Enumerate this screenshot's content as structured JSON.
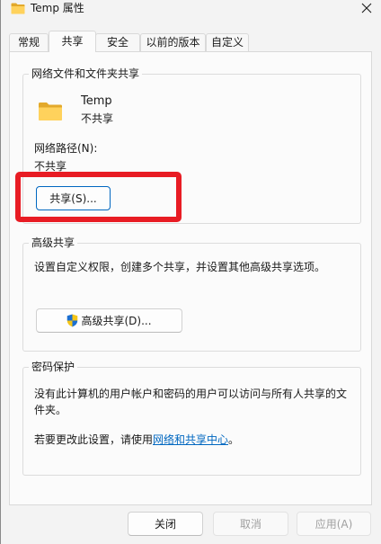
{
  "window": {
    "title": "Temp 属性",
    "title_icon": "folder-icon",
    "close_icon": "close-icon"
  },
  "tabs": [
    {
      "label": "常规",
      "selected": false
    },
    {
      "label": "共享",
      "selected": true
    },
    {
      "label": "安全",
      "selected": false
    },
    {
      "label": "以前的版本",
      "selected": false
    },
    {
      "label": "自定义",
      "selected": false
    }
  ],
  "network_sharing": {
    "group_label": "网络文件和文件夹共享",
    "folder_icon": "folder-icon",
    "folder_name": "Temp",
    "folder_status": "不共享",
    "path_label": "网络路径(N):",
    "path_value": "不共享",
    "share_button": "共享(S)..."
  },
  "advanced_sharing": {
    "group_label": "高级共享",
    "description": "设置自定义权限，创建多个共享，并设置其他高级共享选项。",
    "button_icon": "uac-shield-icon",
    "button": "高级共享(D)..."
  },
  "password_protection": {
    "group_label": "密码保护",
    "description_lines": [
      "没有此计算机的用户帐户和密码的用户可以访问与所有人共享的文",
      "件夹。"
    ],
    "change_prefix": "若要更改此设置，请使用",
    "link": "网络和共享中心",
    "change_suffix": "。"
  },
  "footer": {
    "close_button": {
      "label": "关闭",
      "enabled": true
    },
    "cancel_button": {
      "label": "取消",
      "enabled": false
    },
    "apply_button": {
      "label": "应用(A)",
      "enabled": false
    }
  },
  "colors": {
    "accent": "#0067c0",
    "link": "#0067c0",
    "annotation": "#e81c24",
    "disabled_text": "#a0a0a0",
    "folder": "#ffd25c"
  }
}
